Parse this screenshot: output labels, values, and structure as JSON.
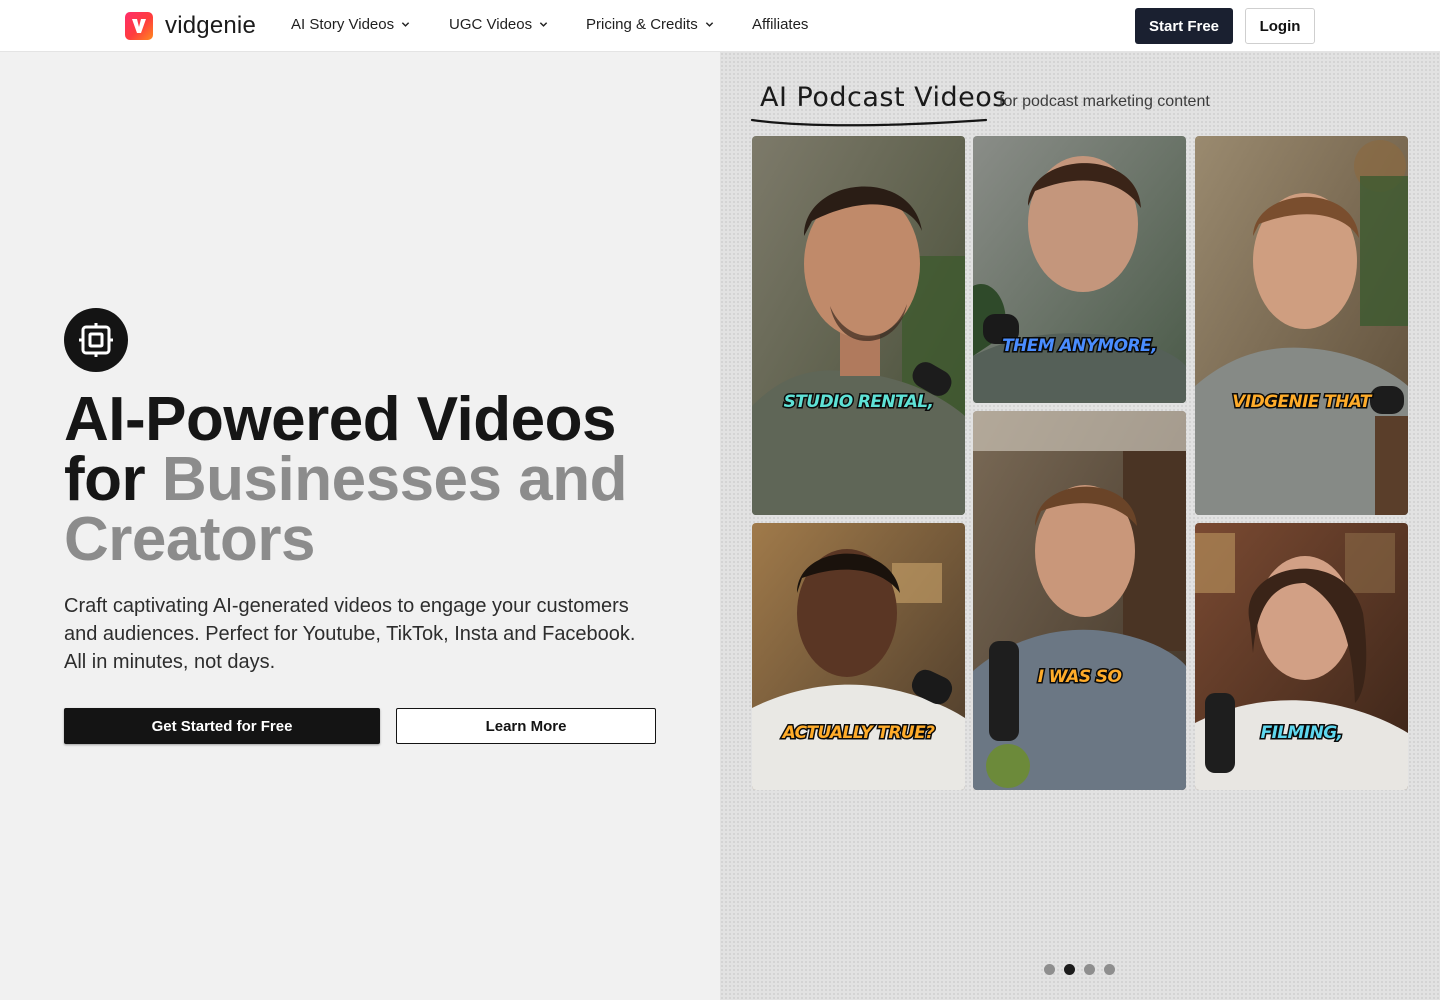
{
  "nav": {
    "brand": "vidgenie",
    "items": [
      {
        "label": "AI Story Videos",
        "dropdown": true
      },
      {
        "label": "UGC Videos",
        "dropdown": true
      },
      {
        "label": "Pricing & Credits",
        "dropdown": true
      },
      {
        "label": "Affiliates",
        "dropdown": false
      }
    ],
    "start_label": "Start Free",
    "login_label": "Login"
  },
  "hero": {
    "icon": "frame-icon",
    "headline_dark_1": "AI-Powered Videos",
    "headline_dark_2": "for",
    "headline_muted": "Businesses and Creators",
    "subcopy": "Craft captivating AI-generated videos to engage your customers and audiences. Perfect for Youtube, TikTok, Insta and Facebook. All in minutes, not days.",
    "primary_label": "Get Started for Free",
    "secondary_label": "Learn More"
  },
  "showcase": {
    "title": "AI Podcast Videos",
    "subtitle": "for podcast marketing content",
    "cards": [
      {
        "caption": "STUDIO RENTAL,",
        "caption_color": "#5fe2d6"
      },
      {
        "caption": "THEM ANYMORE,",
        "caption_color": "#4a8dff"
      },
      {
        "caption": "VIDGENIE THAT",
        "caption_color": "#ffac2a"
      },
      {
        "caption": "ACTUALLY TRUE?",
        "caption_color": "#ffac2a"
      },
      {
        "caption": "I WAS SO",
        "caption_color": "#ffac2a"
      },
      {
        "caption": "FILMING,",
        "caption_color": "#5fd8ef"
      }
    ],
    "slides_total": 4,
    "slide_active": 2
  },
  "colors": {
    "accent_dark": "#141414",
    "start_button": "#1a2030",
    "muted_text": "#8c8c8c",
    "brand_gradient": [
      "#ff2d6a",
      "#ff8a1f"
    ]
  }
}
